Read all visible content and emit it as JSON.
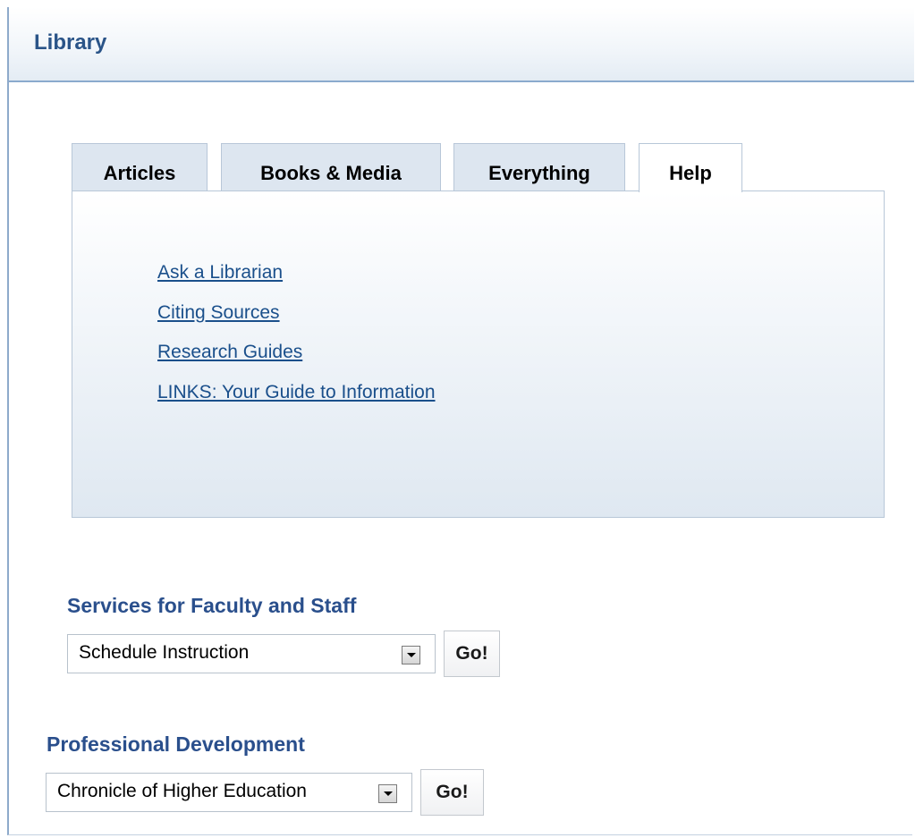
{
  "header": {
    "title": "Library"
  },
  "tabs": [
    {
      "label": "Articles",
      "active": false
    },
    {
      "label": "Books & Media",
      "active": false
    },
    {
      "label": "Everything",
      "active": false
    },
    {
      "label": "Help",
      "active": true
    }
  ],
  "help_links": [
    "Ask a Librarian",
    "Citing Sources",
    "Research Guides",
    "LINKS: Your Guide to Information"
  ],
  "faculty_services": {
    "heading": "Services for Faculty and Staff",
    "selected": "Schedule Instruction",
    "button_label": "Go!"
  },
  "professional_development": {
    "heading": "Professional Development",
    "selected": "Chronicle of Higher Education",
    "button_label": "Go!"
  },
  "colors": {
    "title": "#2a5488",
    "heading": "#2a4f8c",
    "link": "#1a4f8b",
    "tab_inactive_bg": "#dde6f0",
    "panel_border": "#8aaacd"
  }
}
